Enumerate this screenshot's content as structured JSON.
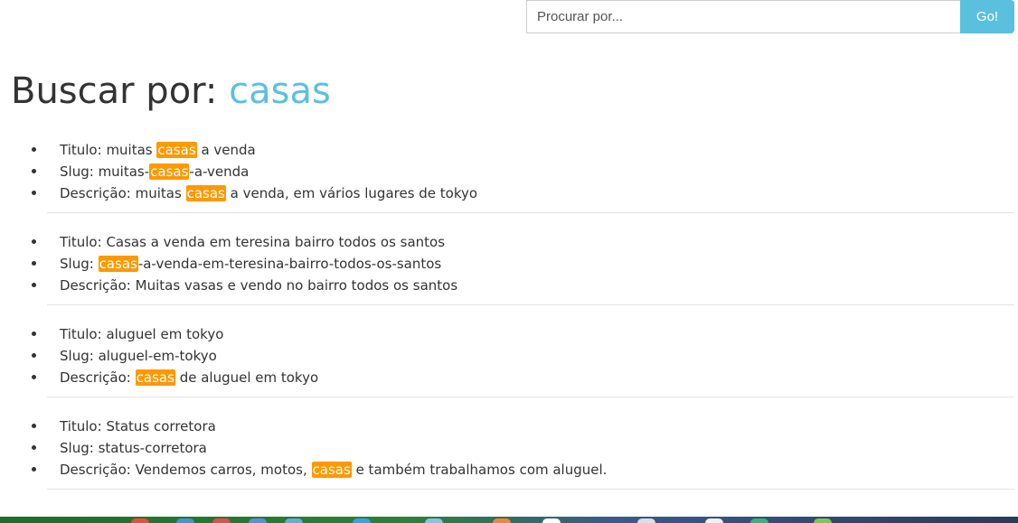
{
  "search": {
    "placeholder": "Procurar por...",
    "button_label": "Go!"
  },
  "header": {
    "prefix": "Buscar por:",
    "term": "casas"
  },
  "results": [
    {
      "titulo": {
        "label": "Titulo:",
        "before": "muitas",
        "hl": "casas",
        "after": "a venda"
      },
      "slug": {
        "label": "Slug:",
        "before": "muitas-",
        "hl": "casas",
        "after": "-a-venda"
      },
      "descricao": {
        "label": "Descrição:",
        "before": "muitas",
        "hl": "casas",
        "after": "a venda, em vários lugares de tokyo"
      }
    },
    {
      "titulo": {
        "label": "Titulo:",
        "text": "Casas a venda em teresina bairro todos os santos"
      },
      "slug": {
        "label": "Slug:",
        "hl": "casas",
        "after": "-a-venda-em-teresina-bairro-todos-os-santos"
      },
      "descricao": {
        "label": "Descrição:",
        "text": "Muitas vasas e vendo no bairro todos os santos"
      }
    },
    {
      "titulo": {
        "label": "Titulo:",
        "text": "aluguel em tokyo"
      },
      "slug": {
        "label": "Slug:",
        "text": "aluguel-em-tokyo"
      },
      "descricao": {
        "label": "Descrição:",
        "hl": "casas",
        "after": "de aluguel em tokyo"
      }
    },
    {
      "titulo": {
        "label": "Titulo:",
        "text": "Status corretora"
      },
      "slug": {
        "label": "Slug:",
        "text": "status-corretora"
      },
      "descricao": {
        "label": "Descrição:",
        "before": "Vendemos carros, motos,",
        "hl": "casas",
        "after": "e também trabalhamos com aluguel."
      }
    }
  ],
  "colors": {
    "accent": "#5bc0de",
    "highlight": "#ff9900",
    "text": "#333333"
  }
}
